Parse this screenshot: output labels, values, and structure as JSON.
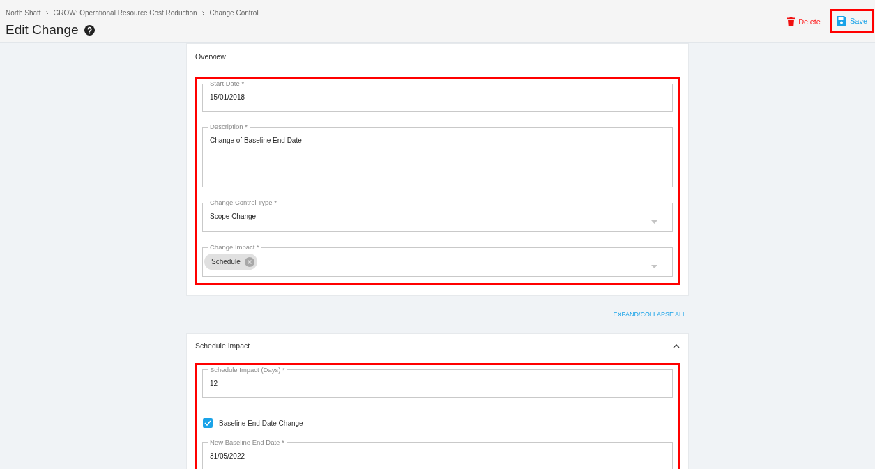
{
  "breadcrumbs": [
    "North Shaft",
    "GROW: Operational Resource Cost Reduction",
    "Change Control"
  ],
  "title": "Edit Change",
  "actions": [
    {
      "kind": "delete",
      "label": "Delete",
      "highlighted": false
    },
    {
      "kind": "save",
      "label": "Save",
      "highlighted": true
    }
  ],
  "overview": {
    "title": "Overview",
    "highlighted": true,
    "fields": [
      {
        "kind": "text",
        "label": "Start Date *",
        "value": "15/01/2018"
      },
      {
        "kind": "textarea",
        "label": "Description *",
        "value": "Change of Baseline End Date"
      },
      {
        "kind": "select",
        "label": "Change Control Type *",
        "value": "Scope Change"
      },
      {
        "kind": "chips",
        "label": "Change Impact *",
        "chips": [
          "Schedule"
        ]
      }
    ]
  },
  "expand_collapse": "EXPAND/COLLAPSE ALL",
  "schedule_impact": {
    "title": "Schedule Impact",
    "expanded": true,
    "highlighted": true,
    "fields": [
      {
        "kind": "text",
        "label": "Schedule Impact (Days) *",
        "value": "12"
      },
      {
        "kind": "checkbox",
        "label": "Baseline End Date Change",
        "checked": true
      },
      {
        "kind": "text",
        "label": "New Baseline End Date *",
        "value": "31/05/2022"
      }
    ]
  }
}
